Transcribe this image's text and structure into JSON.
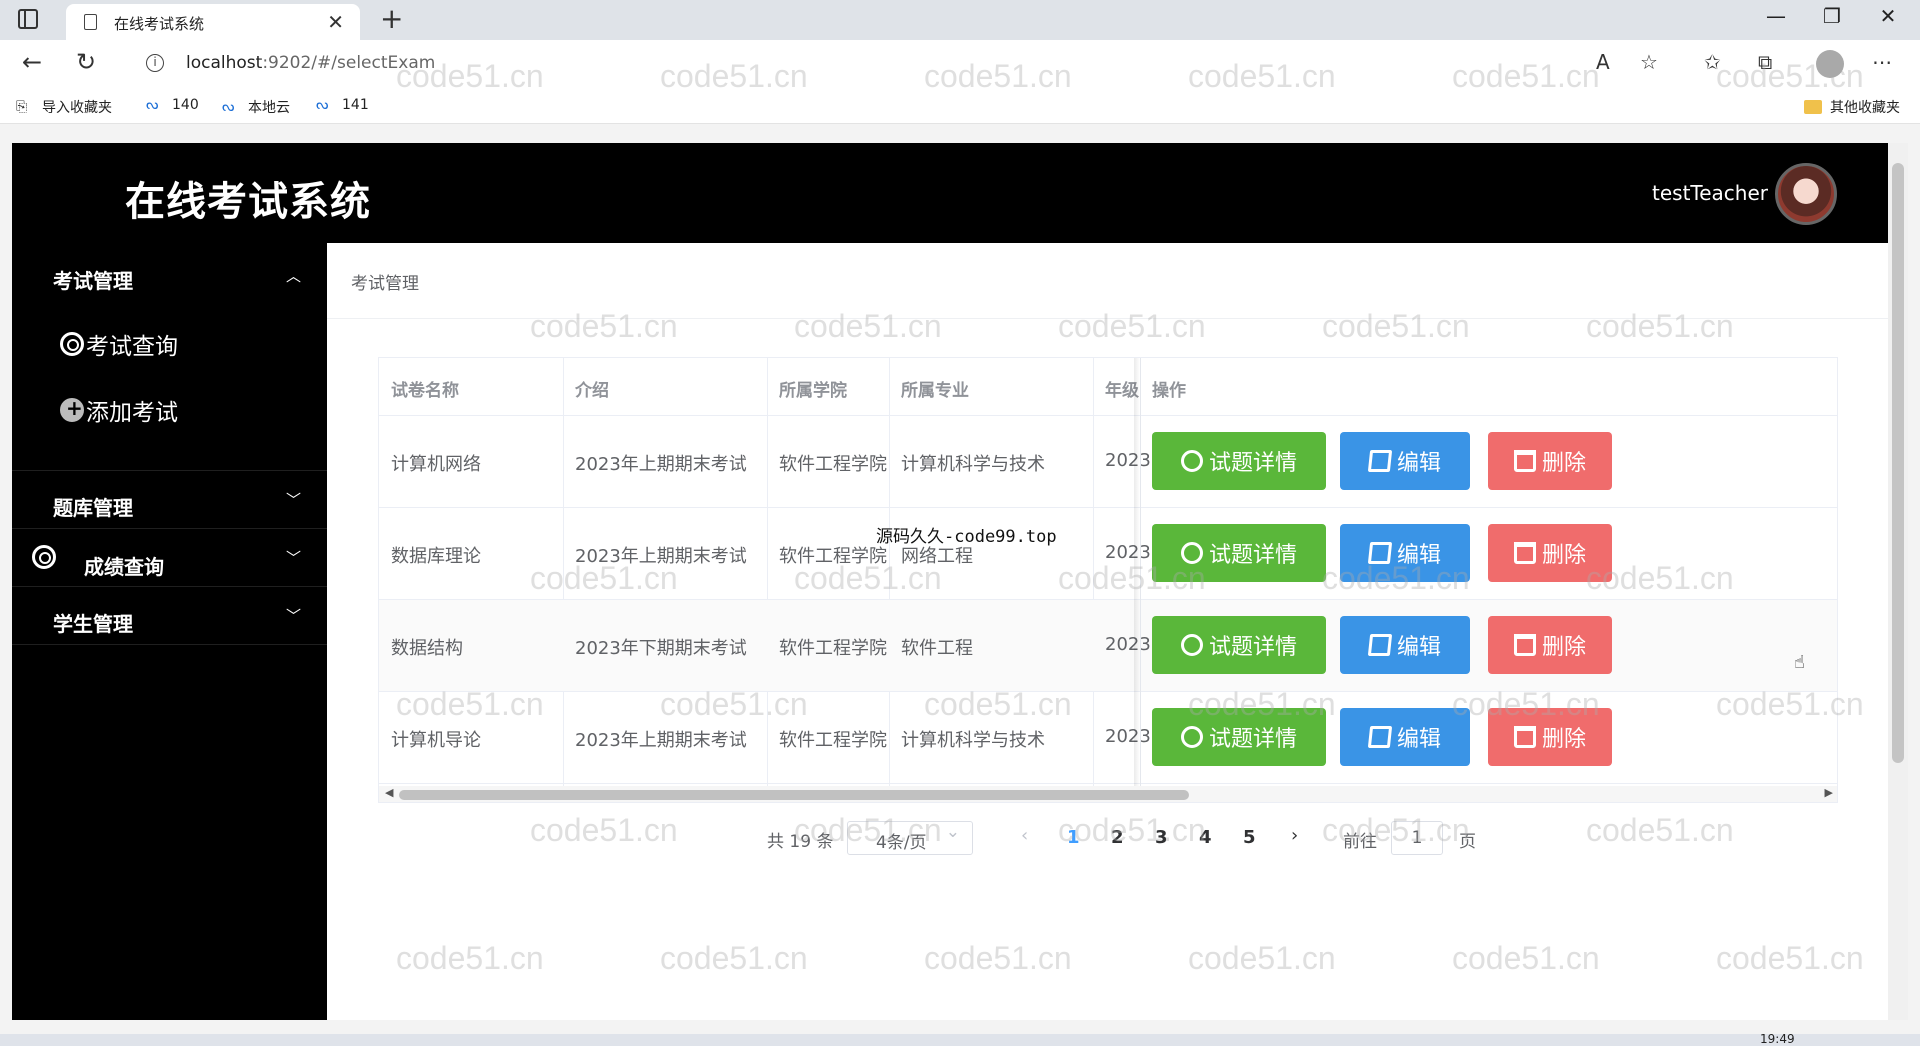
{
  "browser": {
    "tab_title": "在线考试系统",
    "url_host": "localhost",
    "url_rest": ":9202/#/selectExam",
    "bookmarks": [
      "导入收藏夹",
      "140",
      "本地云",
      "141"
    ],
    "other_bookmarks": "其他收藏夹"
  },
  "app": {
    "title": "在线考试系统",
    "username": "testTeacher"
  },
  "sidebar": {
    "groups": [
      {
        "label": "考试管理",
        "items": [
          "考试查询",
          "添加考试"
        ]
      },
      {
        "label": "题库管理"
      },
      {
        "label": "成绩查询"
      },
      {
        "label": "学生管理"
      }
    ]
  },
  "breadcrumb": "考试管理",
  "table": {
    "headers": [
      "试卷名称",
      "介绍",
      "所属学院",
      "所属专业",
      "年级",
      "操作"
    ],
    "rows": [
      [
        "计算机网络",
        "2023年上期期末考试",
        "软件工程学院",
        "计算机科学与技术",
        "2023"
      ],
      [
        "数据库理论",
        "2023年上期期末考试",
        "软件工程学院",
        "网络工程",
        "2023"
      ],
      [
        "数据结构",
        "2023年下期期末考试",
        "软件工程学院",
        "软件工程",
        "2023"
      ],
      [
        "计算机导论",
        "2023年上期期末考试",
        "软件工程学院",
        "计算机科学与技术",
        "2023"
      ]
    ],
    "actions": {
      "detail": "试题详情",
      "edit": "编辑",
      "delete": "删除"
    }
  },
  "pagination": {
    "total": "共 19 条",
    "page_size": "4条/页",
    "pages": [
      "1",
      "2",
      "3",
      "4",
      "5"
    ],
    "current": "1",
    "goto_label": "前往",
    "goto_value": "1",
    "goto_unit": "页"
  },
  "overlay_text": "源码久久-code99.top",
  "watermark": "code51.cn",
  "clock": "19:49"
}
